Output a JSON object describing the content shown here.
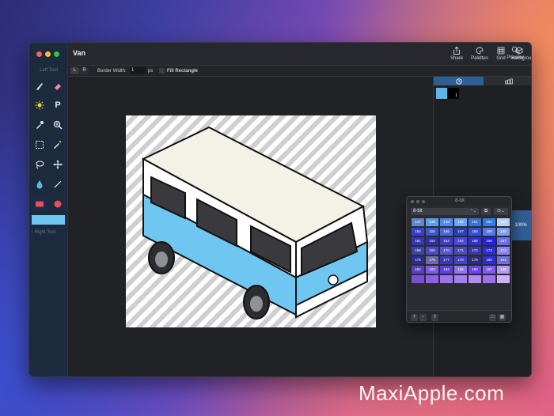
{
  "window": {
    "title": "Van"
  },
  "sidebar": {
    "left_tool_label": "Left Tool",
    "right_tool_label": "Right Tool",
    "selected_color": "#6fc6f0",
    "tools": [
      {
        "name": "brush-tool",
        "icon": "brush-icon"
      },
      {
        "name": "eraser-tool",
        "icon": "eraser-icon"
      },
      {
        "name": "brightness-tool",
        "icon": "sun-icon"
      },
      {
        "name": "pen-tool",
        "icon": "letter-p-icon",
        "glyph": "P"
      },
      {
        "name": "eyedropper-tool",
        "icon": "eyedropper-icon"
      },
      {
        "name": "zoom-tool",
        "icon": "magnifier-plus-icon"
      },
      {
        "name": "marquee-tool",
        "icon": "dashed-square-icon"
      },
      {
        "name": "magic-wand-tool",
        "icon": "magic-wand-icon"
      },
      {
        "name": "lasso-tool",
        "icon": "lasso-icon"
      },
      {
        "name": "move-tool",
        "icon": "move-arrows-icon"
      },
      {
        "name": "fill-tool",
        "icon": "droplet-icon"
      },
      {
        "name": "line-tool",
        "icon": "line-icon"
      },
      {
        "name": "rectangle-tool",
        "icon": "rectangle-icon"
      },
      {
        "name": "ellipse-tool",
        "icon": "circle-icon"
      }
    ]
  },
  "toolbar": {
    "share": "Share",
    "palettes": "Palettes",
    "grid": "Grid",
    "background": "Background",
    "preview": "Preview"
  },
  "options": {
    "left_button": "L",
    "right_button": "R",
    "border_width_label": "Border Width:",
    "border_width_value": "1",
    "unit": "px",
    "fill_rectangle_label": "Fill Rectangle"
  },
  "inspector": {
    "tabs": [
      "clock-icon",
      "layers-icon"
    ],
    "layer_badge": "1"
  },
  "zoom_level": "100%",
  "palette": {
    "title": "8-bit",
    "selected": "8-bit",
    "swatches": [
      {
        "n": "147",
        "c": "#5f88c7"
      },
      {
        "n": "148",
        "c": "#5b9ee6"
      },
      {
        "n": "149",
        "c": "#4f8cf0"
      },
      {
        "n": "150",
        "c": "#6aa6f2"
      },
      {
        "n": "151",
        "c": "#3e70d6"
      },
      {
        "n": "152",
        "c": "#2f7be8"
      },
      {
        "n": "153",
        "c": "#b9d2f7"
      },
      {
        "n": "154",
        "c": "#3c3cd0"
      },
      {
        "n": "155",
        "c": "#3f56c8"
      },
      {
        "n": "156",
        "c": "#4c66d7"
      },
      {
        "n": "157",
        "c": "#2b3fb8"
      },
      {
        "n": "158",
        "c": "#3450d6"
      },
      {
        "n": "159",
        "c": "#5876e4"
      },
      {
        "n": "160",
        "c": "#7f9ded"
      },
      {
        "n": "161",
        "c": "#3535b7"
      },
      {
        "n": "162",
        "c": "#2f2fa2"
      },
      {
        "n": "163",
        "c": "#3c3cc8"
      },
      {
        "n": "164",
        "c": "#4848dc"
      },
      {
        "n": "165",
        "c": "#3030d2"
      },
      {
        "n": "166",
        "c": "#2222e0"
      },
      {
        "n": "167",
        "c": "#6e6ef0"
      },
      {
        "n": "168",
        "c": "#3b43a8"
      },
      {
        "n": "169",
        "c": "#4a4ac2"
      },
      {
        "n": "170",
        "c": "#5757cf"
      },
      {
        "n": "171",
        "c": "#4b4bb6"
      },
      {
        "n": "172",
        "c": "#3838aa"
      },
      {
        "n": "173",
        "c": "#2c2cd8"
      },
      {
        "n": "174",
        "c": "#8787ef"
      },
      {
        "n": "175",
        "c": "#2c2c97"
      },
      {
        "n": "176",
        "c": "#6a6aa8"
      },
      {
        "n": "177",
        "c": "#3a3ab0"
      },
      {
        "n": "178",
        "c": "#4242c4"
      },
      {
        "n": "179",
        "c": "#2c2c74"
      },
      {
        "n": "180",
        "c": "#2d2dd6"
      },
      {
        "n": "181",
        "c": "#6f6fd8"
      },
      {
        "n": "182",
        "c": "#5a3fc2"
      },
      {
        "n": "183",
        "c": "#7b5ce0"
      },
      {
        "n": "184",
        "c": "#5f3fe0"
      },
      {
        "n": "185",
        "c": "#8f74ec"
      },
      {
        "n": "186",
        "c": "#6a43ea"
      },
      {
        "n": "187",
        "c": "#7f5af0"
      },
      {
        "n": "188",
        "c": "#b49af5"
      },
      {
        "n": "",
        "c": "#7a4fd6"
      },
      {
        "n": "",
        "c": "#8a62e8"
      },
      {
        "n": "",
        "c": "#9b72f0"
      },
      {
        "n": "",
        "c": "#a67ef2"
      },
      {
        "n": "",
        "c": "#b28af4"
      },
      {
        "n": "",
        "c": "#9f6ff0"
      },
      {
        "n": "",
        "c": "#c9b2f8"
      }
    ]
  },
  "watermark": "MaxiApple.com"
}
